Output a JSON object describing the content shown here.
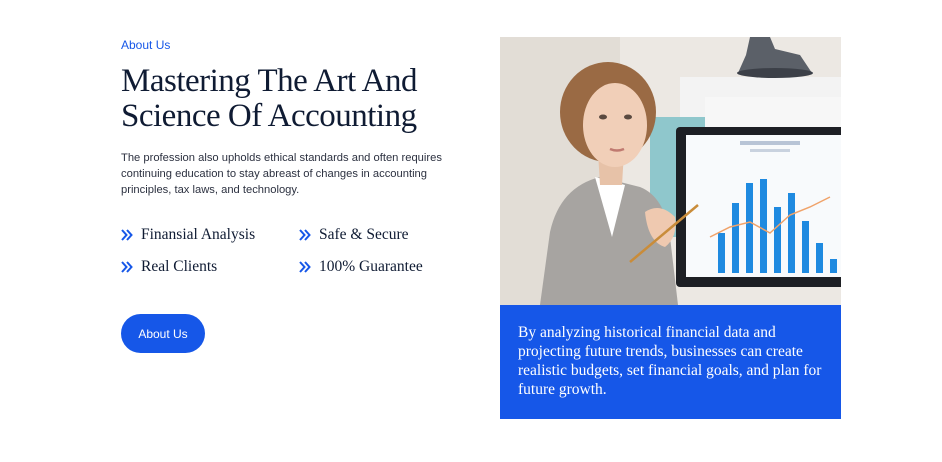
{
  "section": {
    "eyebrow": "About Us",
    "title": "Mastering The Art And Science Of Accounting",
    "description": "The profession also upholds ethical standards and often requires continuing education to stay abreast of changes in accounting principles, tax laws, and technology."
  },
  "features": [
    {
      "label": "Finansial Analysis",
      "icon": "double-chevron-right-icon"
    },
    {
      "label": "Safe & Secure",
      "icon": "double-chevron-right-icon"
    },
    {
      "label": "Real Clients",
      "icon": "double-chevron-right-icon"
    },
    {
      "label": "100% Guarantee",
      "icon": "double-chevron-right-icon"
    }
  ],
  "cta": {
    "label": "About Us"
  },
  "image": {
    "caption": "By analyzing historical financial data and projecting future trends, businesses can create realistic budgets, set financial goals, and plan for future growth."
  },
  "colors": {
    "accent": "#1657e8",
    "heading": "#0f1b33",
    "body": "#2c3140"
  }
}
